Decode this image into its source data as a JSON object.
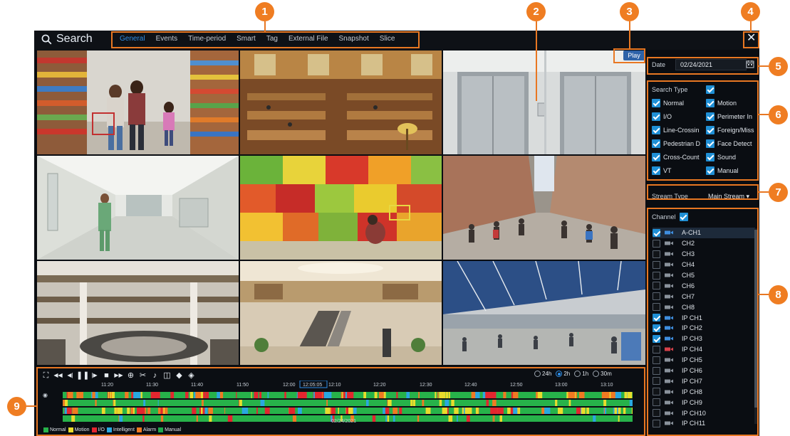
{
  "window": {
    "title": "Search",
    "close_glyph": "✕"
  },
  "tabs": [
    "General",
    "Events",
    "Time-period",
    "Smart",
    "Tag",
    "External File",
    "Snapshot",
    "Slice"
  ],
  "active_tab": 0,
  "play_label": "Play",
  "date": {
    "label": "Date",
    "value": "02/24/2021"
  },
  "search_type": {
    "label": "Search Type",
    "items": [
      "Normal",
      "Motion",
      "I/O",
      "Perimeter In",
      "Line-Crossin",
      "Foreign/Miss",
      "Pedestrian D",
      "Face Detect",
      "Cross-Count",
      "Sound",
      "VT",
      "Manual"
    ]
  },
  "stream": {
    "label": "Stream Type",
    "value": "Main Stream"
  },
  "channel": {
    "label": "Channel",
    "items": [
      {
        "name": "A-CH1",
        "checked": true,
        "selected": true,
        "cam": "blue"
      },
      {
        "name": "CH2",
        "checked": false,
        "cam": "gray"
      },
      {
        "name": "CH3",
        "checked": false,
        "cam": "gray"
      },
      {
        "name": "CH4",
        "checked": false,
        "cam": "gray"
      },
      {
        "name": "CH5",
        "checked": false,
        "cam": "gray"
      },
      {
        "name": "CH6",
        "checked": false,
        "cam": "gray"
      },
      {
        "name": "CH7",
        "checked": false,
        "cam": "gray"
      },
      {
        "name": "CH8",
        "checked": false,
        "cam": "gray"
      },
      {
        "name": "IP CH1",
        "checked": true,
        "cam": "blue"
      },
      {
        "name": "IP CH2",
        "checked": true,
        "cam": "blue"
      },
      {
        "name": "IP CH3",
        "checked": true,
        "cam": "blue"
      },
      {
        "name": "IP CH4",
        "checked": false,
        "cam": "red"
      },
      {
        "name": "IP CH5",
        "checked": false,
        "cam": "gray"
      },
      {
        "name": "IP CH6",
        "checked": false,
        "cam": "gray"
      },
      {
        "name": "IP CH7",
        "checked": false,
        "cam": "gray"
      },
      {
        "name": "IP CH8",
        "checked": false,
        "cam": "gray"
      },
      {
        "name": "IP CH9",
        "checked": false,
        "cam": "gray"
      },
      {
        "name": "IP CH10",
        "checked": false,
        "cam": "gray"
      },
      {
        "name": "IP CH11",
        "checked": false,
        "cam": "gray"
      }
    ]
  },
  "timeline": {
    "tools": [
      "fullscreen-icon",
      "rewind-icon",
      "step-back-icon",
      "pause-icon",
      "step-forward-icon",
      "stop-icon",
      "fast-forward-icon",
      "zoom-icon",
      "cut-icon",
      "volume-icon",
      "snapshot-icon",
      "tag-icon",
      "tag-edit-icon"
    ],
    "ranges": [
      "24h",
      "2h",
      "1h",
      "30m"
    ],
    "range_selected": "2h",
    "times": [
      "11:20",
      "11:30",
      "11:40",
      "11:50",
      "12:00",
      "12:05:05",
      "12:10",
      "12:20",
      "12:30",
      "12:40",
      "12:50",
      "13:00",
      "13:10"
    ],
    "current_time": "12:05:05",
    "date": "02/24/2021",
    "legend": [
      {
        "label": "Normal",
        "color": "#27b24a"
      },
      {
        "label": "Motion",
        "color": "#e8dc2c"
      },
      {
        "label": "I/O",
        "color": "#e3262f"
      },
      {
        "label": "Intelligent",
        "color": "#29a8e0"
      },
      {
        "label": "Alarm",
        "color": "#f07a22"
      },
      {
        "label": "Manual",
        "color": "#1ea84a"
      }
    ]
  },
  "annotations": [
    "1",
    "2",
    "3",
    "4",
    "5",
    "6",
    "7",
    "8",
    "9"
  ]
}
